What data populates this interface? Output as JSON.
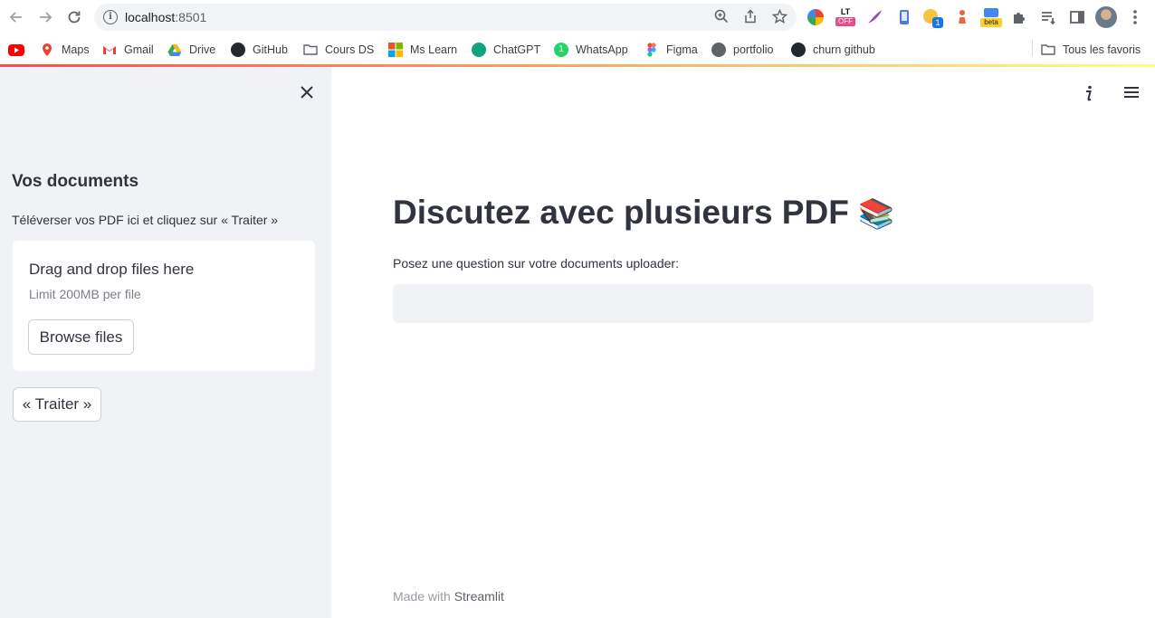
{
  "browser": {
    "url_host": "localhost",
    "url_port": ":8501",
    "bookmarks": [
      {
        "label": "",
        "icon": "youtube-icon",
        "color": "#ff0000"
      },
      {
        "label": "Maps",
        "icon": "maps-icon",
        "color": "#34a853"
      },
      {
        "label": "Gmail",
        "icon": "gmail-icon",
        "color": "#ea4335"
      },
      {
        "label": "Drive",
        "icon": "drive-icon",
        "color": "#fbbc04"
      },
      {
        "label": "GitHub",
        "icon": "github-icon",
        "color": "#24292f"
      },
      {
        "label": "Cours DS",
        "icon": "folder-icon",
        "color": "#5f6368"
      },
      {
        "label": "Ms Learn",
        "icon": "microsoft-icon",
        "color": "#f25022"
      },
      {
        "label": "ChatGPT",
        "icon": "chatgpt-icon",
        "color": "#10a37f"
      },
      {
        "label": "WhatsApp",
        "icon": "whatsapp-icon",
        "color": "#25d366"
      },
      {
        "label": "Figma",
        "icon": "figma-icon",
        "color": "#f24e1e"
      },
      {
        "label": "portfolio",
        "icon": "globe-icon",
        "color": "#5f6368"
      },
      {
        "label": "churn github",
        "icon": "github-icon",
        "color": "#24292f"
      }
    ],
    "all_bookmarks_label": "Tous les favoris",
    "extension_badges": {
      "lt": "LT",
      "off": "OFF",
      "count": "1",
      "beta": "beta"
    }
  },
  "sidebar": {
    "title": "Vos documents",
    "caption": "Téléverser vos PDF ici et cliquez sur « Traiter »",
    "uploader": {
      "title": "Drag and drop files here",
      "limit": "Limit 200MB per file",
      "browse_label": "Browse files"
    },
    "process_label": "« Traiter »"
  },
  "main": {
    "title": "Discutez avec plusieurs PDF",
    "title_emoji": "📚",
    "question_label": "Posez une question sur votre documents uploader:",
    "question_value": "",
    "footer_prefix": "Made with ",
    "footer_brand": "Streamlit"
  },
  "colors": {
    "accent": "#ff4b4b",
    "sidebar_bg": "#f0f2f6",
    "text": "#31333f"
  }
}
